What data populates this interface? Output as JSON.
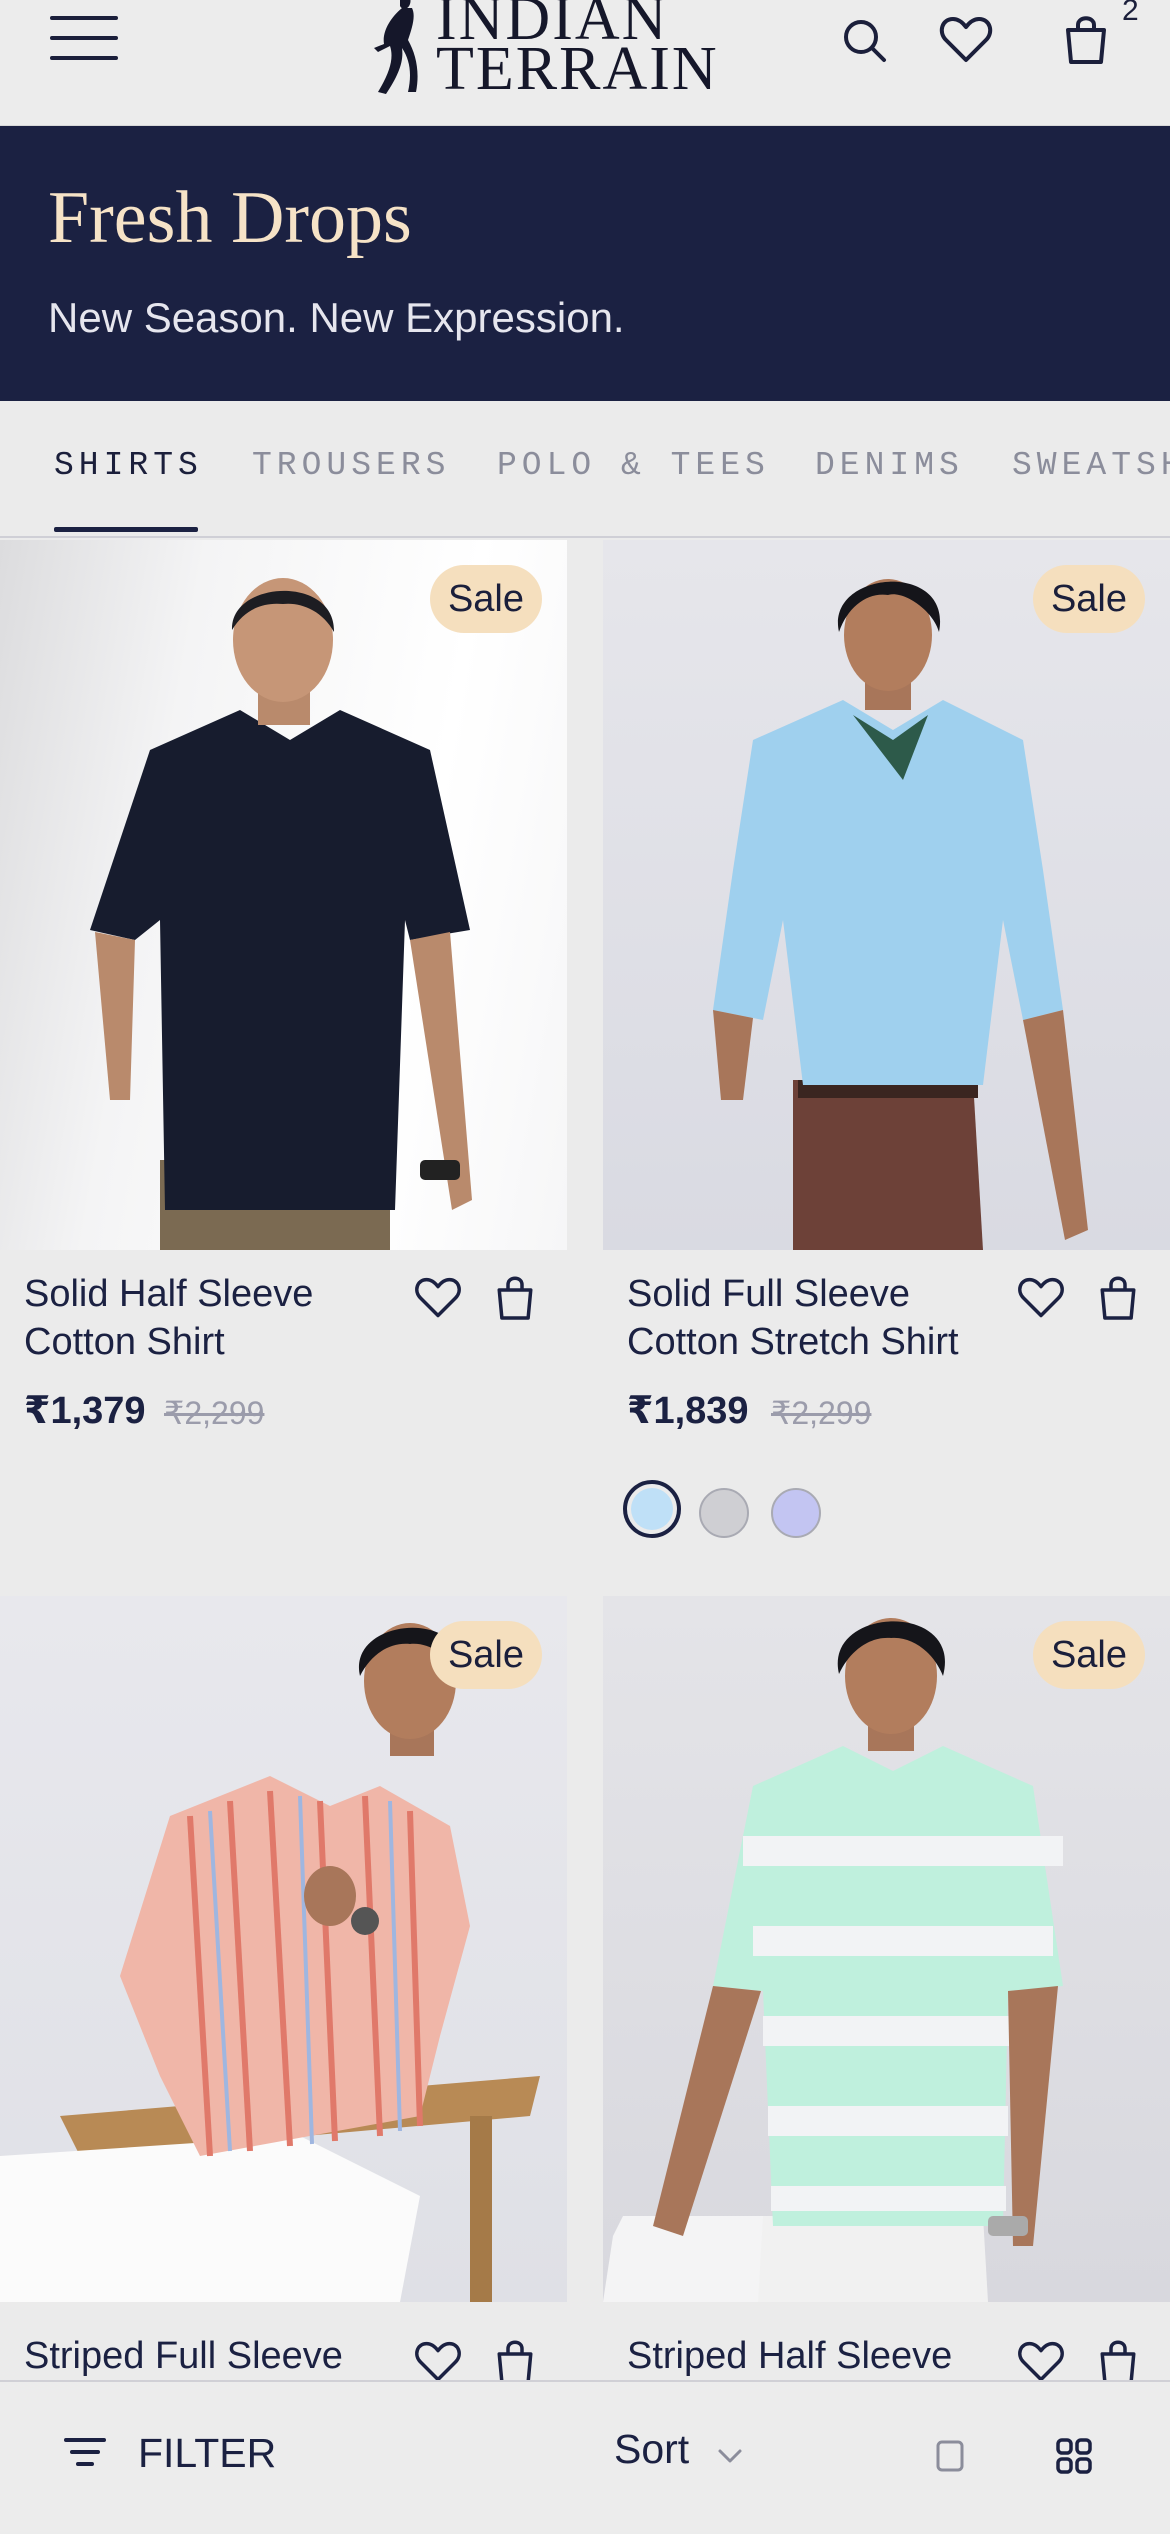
{
  "header": {
    "logo_line1": "INDIAN",
    "logo_line2": "TERRAIN",
    "cart_count": "2"
  },
  "banner": {
    "title": "Fresh Drops",
    "subtitle": "New Season. New Expression."
  },
  "tabs": [
    {
      "label": "SHIRTS",
      "active": true
    },
    {
      "label": "TROUSERS"
    },
    {
      "label": "POLO & TEES"
    },
    {
      "label": "DENIMS"
    },
    {
      "label": "SWEATSH"
    }
  ],
  "products": [
    {
      "badge": "Sale",
      "name": "Solid Half Sleeve Cotton Shirt",
      "price": "₹1,379",
      "mrp": "₹2,299"
    },
    {
      "badge": "Sale",
      "name": "Solid Full Sleeve Cotton Stretch Shirt",
      "price": "₹1,839",
      "mrp": "₹2,299",
      "swatches": [
        "#bfe0f7",
        "#cfcfd3",
        "#c3c5f2"
      ],
      "selected_swatch": 0
    },
    {
      "badge": "Sale",
      "name": "Striped Full Sleeve"
    },
    {
      "badge": "Sale",
      "name": "Striped Half Sleeve"
    }
  ],
  "bottom_bar": {
    "filter_label": "FILTER",
    "sort_label": "Sort"
  },
  "colors": {
    "navy": "#1b2142",
    "cream": "#f6e3c7",
    "sale_badge": "#f5dfbe"
  }
}
